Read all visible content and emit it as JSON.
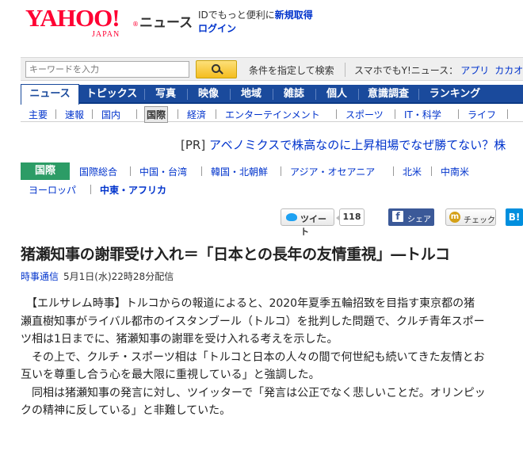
{
  "header": {
    "logo_text": "YAHOO!",
    "logo_reg": "®",
    "logo_sub": "JAPAN",
    "service_name": "ニュース",
    "id_promo": "IDでもっと便利に",
    "register_link": "新規取得",
    "login_link": "ログイン"
  },
  "search": {
    "placeholder": "キーワードを入力",
    "advanced_link": "条件を指定して検索",
    "smartphone_label": "スマホでもY!ニュース：",
    "app_link": "アプリ",
    "kakao_link": "カカオ"
  },
  "main_nav": [
    "ニュース",
    "トピックス",
    "写真",
    "映像",
    "地域",
    "雑誌",
    "個人",
    "意識調査",
    "ランキング"
  ],
  "sub_nav": [
    "主要",
    "速報",
    "国内",
    "国際",
    "経済",
    "エンターテインメント",
    "スポーツ",
    "IT・科学",
    "ライフ"
  ],
  "pr": {
    "tag": "[PR]",
    "text": "アベノミクスで株高なのに上昇相場でなぜ勝てない？株"
  },
  "category": {
    "label": "国際",
    "items": [
      "国際総合",
      "中国・台湾",
      "韓国・北朝鮮",
      "アジア・オセアニア",
      "北米",
      "中南米",
      "ヨーロッパ",
      "中東・アフリカ"
    ]
  },
  "share": {
    "tweet_label": "ツイート",
    "tweet_count": "118",
    "facebook_label": "シェア",
    "mixi_label": "チェック",
    "hatena_label": "B!"
  },
  "article": {
    "title": "猪瀬知事の謝罪受け入れ＝「日本との長年の友情重視」―トルコ",
    "source": "時事通信",
    "date": "5月1日(水)22時28分配信",
    "lines": [
      "　【エルサレム時事】トルコからの報道によると、2020年夏季五輪招致を目指す東京都の猪",
      "瀬直樹知事がライバル都市のイスタンブール（トルコ）を批判した問題で、クルチ青年スポー",
      "ツ相は1日までに、猪瀬知事の謝罪を受け入れる考えを示した。",
      "　その上で、クルチ・スポーツ相は「トルコと日本の人々の間で何世紀も続いてきた友情とお",
      "互いを尊重し合う心を最大限に重視している」と強調した。",
      "　同相は猪瀬知事の発言に対し、ツイッターで「発言は公正でなく悲しいことだ。オリンピッ",
      "クの精神に反している」と非難していた。"
    ]
  }
}
